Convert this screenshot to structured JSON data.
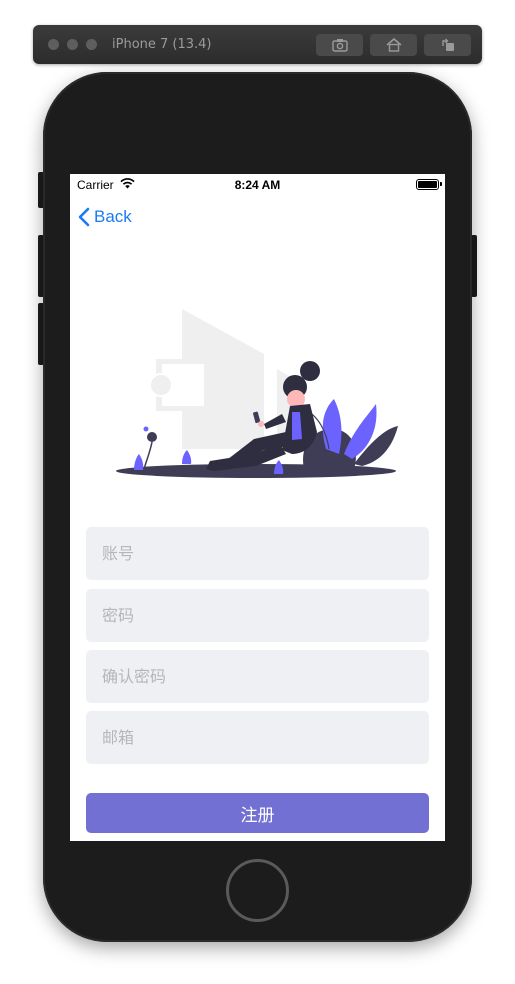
{
  "simulator": {
    "device_title": "iPhone 7 (13.4)",
    "toolbar_buttons": [
      "screenshot-icon",
      "home-icon",
      "rotate-icon"
    ]
  },
  "status_bar": {
    "carrier": "Carrier",
    "time": "8:24 AM"
  },
  "nav": {
    "back_label": "Back"
  },
  "form": {
    "account_placeholder": "账号",
    "password_placeholder": "密码",
    "confirm_placeholder": "确认密码",
    "email_placeholder": "邮箱",
    "submit_label": "注册"
  },
  "colors": {
    "accent": "#7370d3",
    "link": "#1a7cf5",
    "field_bg": "#eff0f3",
    "illustration_purple": "#6c63ff",
    "illustration_dark": "#3f3d56"
  }
}
